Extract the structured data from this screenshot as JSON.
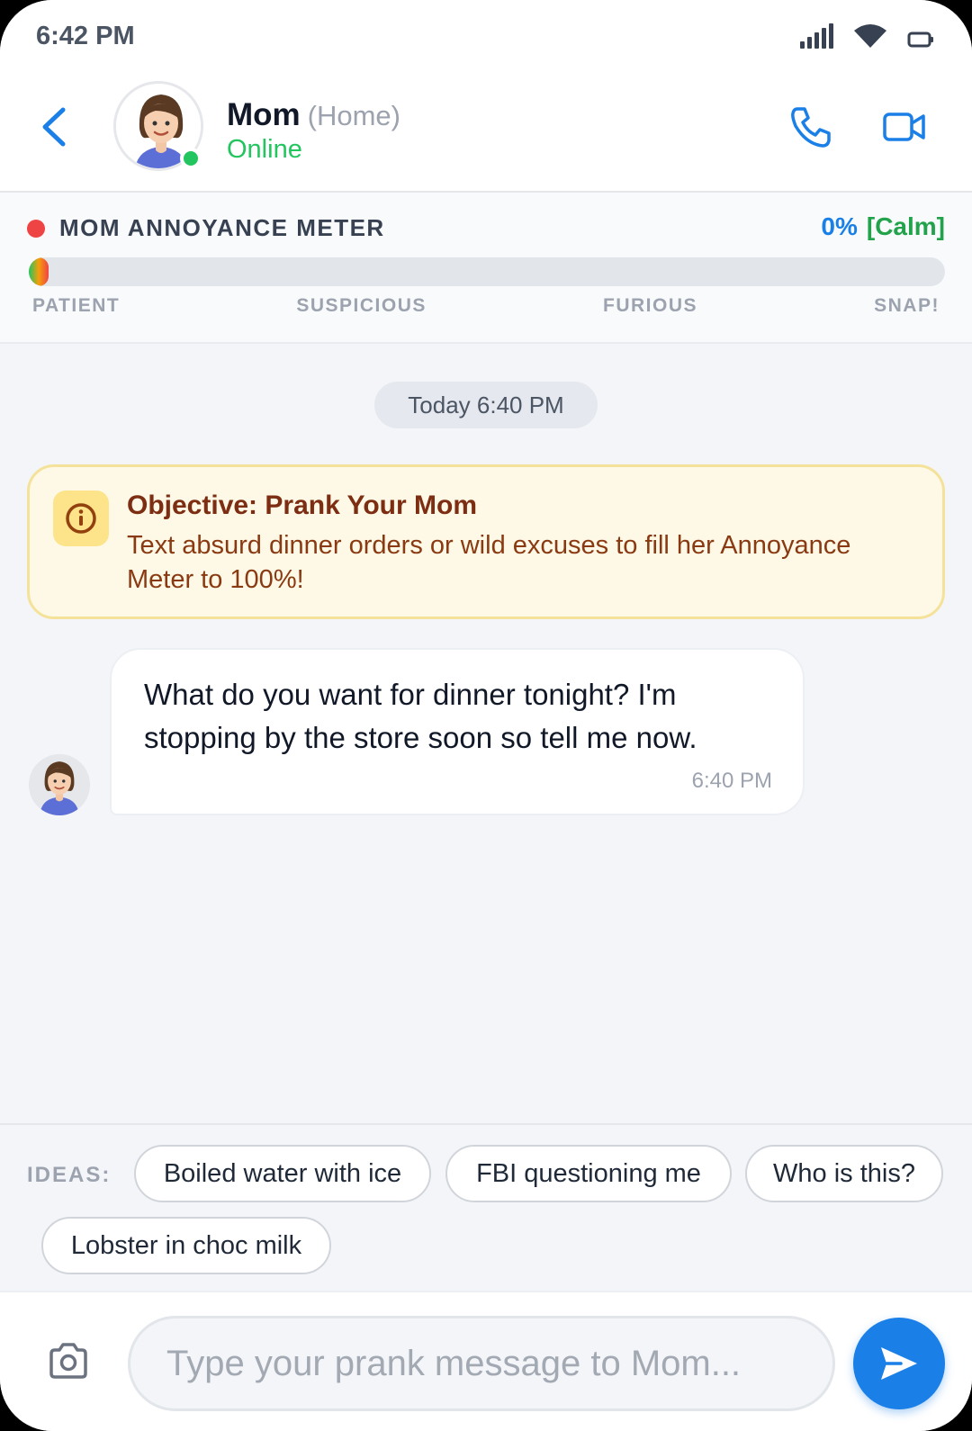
{
  "status_bar": {
    "time": "6:42 PM"
  },
  "header": {
    "contact_name": "Mom",
    "contact_location": "(Home)",
    "contact_status": "Online",
    "accent_color": "#1a7fe6",
    "online_color": "#22c55e"
  },
  "meter": {
    "title": "MOM ANNOYANCE METER",
    "value_text": "0%",
    "value": 0,
    "state_label": "[Calm]",
    "ticks": [
      "PATIENT",
      "SUSPICIOUS",
      "FURIOUS",
      "SNAP!"
    ]
  },
  "chat": {
    "date_chip": "Today 6:40 PM",
    "objective": {
      "title": "Objective: Prank Your Mom",
      "text": "Text absurd dinner orders or wild excuses to fill her Annoyance Meter to 100%!"
    },
    "messages": [
      {
        "sender": "Mom",
        "text": "What do you want for dinner tonight? I'm stopping by the store soon so tell me now.",
        "time": "6:40 PM"
      }
    ]
  },
  "ideas": {
    "label": "IDEAS:",
    "chips": [
      "Boiled water with ice",
      "FBI questioning me",
      "Who is this?",
      "Lobster in choc milk"
    ]
  },
  "composer": {
    "placeholder": "Type your prank message to Mom..."
  },
  "icons": [
    "back-chevron-icon",
    "phone-icon",
    "video-camera-icon",
    "info-icon",
    "camera-icon",
    "send-icon",
    "signal-icon",
    "wifi-icon",
    "battery-icon"
  ]
}
